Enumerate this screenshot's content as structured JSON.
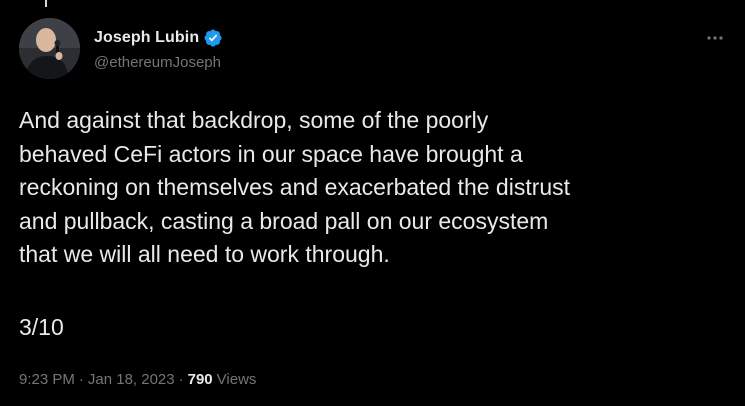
{
  "author": {
    "display_name": "Joseph Lubin",
    "handle": "@ethereumJoseph",
    "verified": true,
    "avatar_icon": "avatar-photo"
  },
  "more_icon": "more-horizontal-icon",
  "tweet": {
    "text": "And against that backdrop, some of the poorly\nbehaved CeFi actors in our space have brought a\nreckoning on themselves and exacerbated the distrust\nand pullback, casting a broad pall on our ecosystem\nthat we will all need to work through.",
    "thread_position": "3/10"
  },
  "meta": {
    "time": "9:23 PM",
    "separator": "·",
    "date": "Jan 18, 2023",
    "views_count": "790",
    "views_label": "Views"
  },
  "colors": {
    "background": "#000000",
    "primary_text": "#e7e9ea",
    "secondary_text": "#71767b",
    "verified_blue": "#1d9bf0"
  }
}
